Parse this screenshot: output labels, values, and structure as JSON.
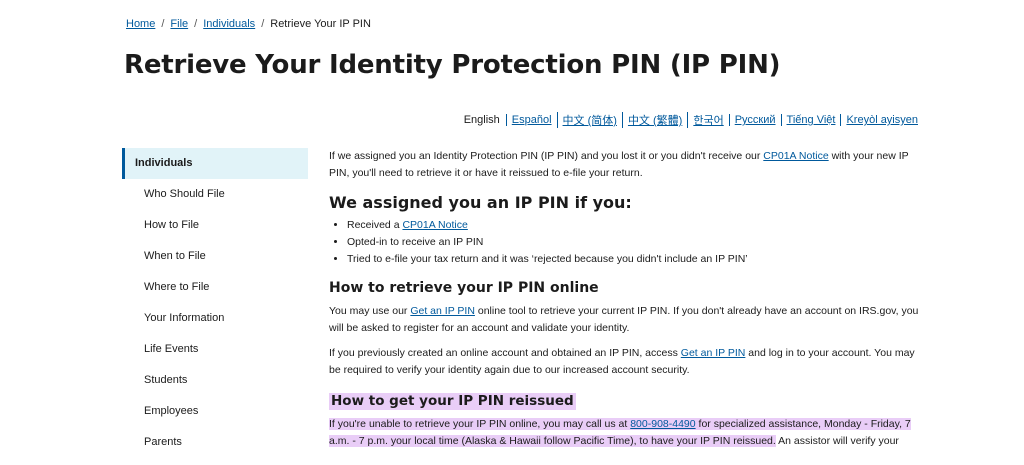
{
  "breadcrumb": {
    "home": "Home",
    "file": "File",
    "individuals": "Individuals",
    "current": "Retrieve Your IP PIN",
    "separator": "/"
  },
  "page": {
    "title": "Retrieve Your Identity Protection PIN (IP PIN)"
  },
  "languages": {
    "current": "English",
    "links": [
      "Español",
      "中文 (简体)",
      "中文 (繁體)",
      "한국어",
      "Русский",
      "Tiếng Việt",
      "Kreyòl ayisyen"
    ]
  },
  "sidebar": {
    "active": "Individuals",
    "items": [
      "Who Should File",
      "How to File",
      "When to File",
      "Where to File",
      "Your Information",
      "Life Events",
      "Students",
      "Employees",
      "Parents"
    ]
  },
  "content": {
    "intro": {
      "before": "If we assigned you an Identity Protection PIN (IP PIN) and you lost it or you didn't receive our ",
      "link": "CP01A Notice",
      "after": " with your new IP PIN, you'll need to retrieve it or have it reissued to e-file your return."
    },
    "section1": {
      "heading": "We assigned you an IP PIN if you:",
      "item1_before": "Received a ",
      "item1_link": "CP01A Notice",
      "item2": "Opted-in to receive an IP PIN",
      "item3": "Tried to e-file your tax return and it was ‘rejected because you didn't include an IP PIN’"
    },
    "section2": {
      "heading": "How to retrieve your IP PIN online",
      "p1_before": "You may use our ",
      "p1_link": "Get an IP PIN",
      "p1_after": " online tool to retrieve your current IP PIN. If you don't already have an account on IRS.gov, you will be asked to register for an account and validate your identity.",
      "p2_before": "If you previously created an online account and obtained an IP PIN, access ",
      "p2_link": "Get an IP PIN",
      "p2_after": " and log in to your account. You may be required to verify your identity again due to our increased account security."
    },
    "section3": {
      "heading": "How to get your IP PIN reissued",
      "p1_hl_before": "If you're unable to retrieve your IP PIN online, you may call us at ",
      "p1_phone": "800-908-4490",
      "p1_hl_after": " for specialized assistance, Monday - Friday, 7 a.m. - 7 p.m. your local time (Alaska & Hawaii follow Pacific Time), to have your IP PIN reissued.",
      "p1_rest": " An assistor will verify your"
    }
  },
  "colors": {
    "link": "#00599c",
    "highlight": "#e9cdf7",
    "sidebar_active_bg": "#e1f3f8"
  }
}
